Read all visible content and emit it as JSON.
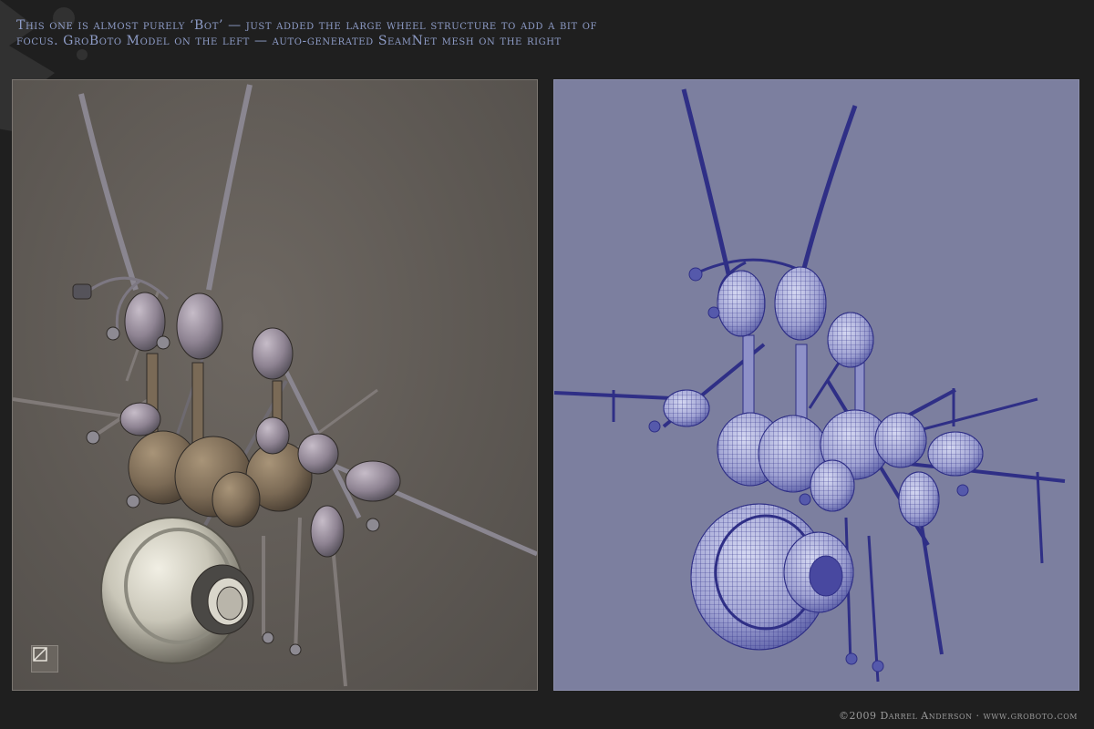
{
  "caption": {
    "line1": "This one is almost purely ‘Bot’ — just added the large wheel structure to add a bit of",
    "line2": "focus. GroBoto Model on the left — auto-generated SeamNet mesh on the right"
  },
  "footer": {
    "copyright": "©2009 Darrel Anderson · www.groboto.com"
  },
  "colors": {
    "background": "#1f1f1f",
    "caption_text": "#8e9cc7",
    "left_panel_bg": "#5d5853",
    "right_panel_bg": "#7c7f9f",
    "mesh_lines": "#3a3a8e",
    "model_brown": "#7a6a56",
    "model_lilac": "#9a8e9c"
  },
  "icons": {
    "left_badge": "cube-frame-icon"
  }
}
